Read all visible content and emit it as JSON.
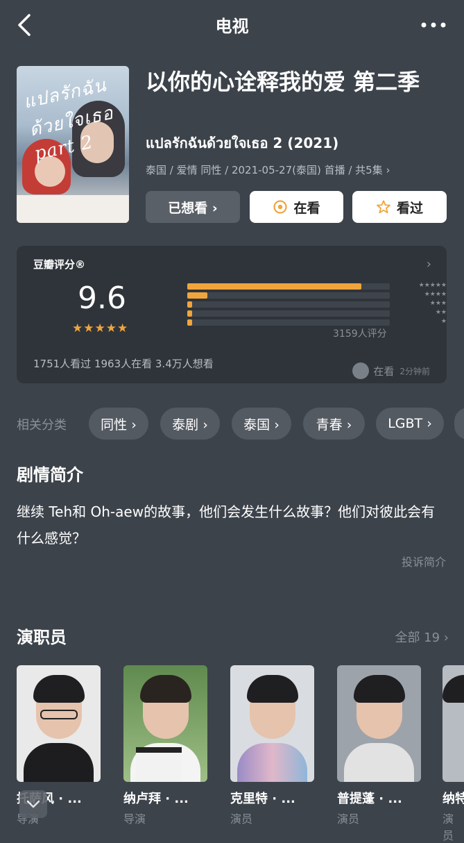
{
  "topbar": {
    "title": "电视"
  },
  "header": {
    "title_cn": "以你的心诠释我的爱 第二季",
    "title_orig": "แปลรักฉันด้วยใจเธอ 2 (2021)",
    "meta": "泰国 / 爱情 同性 / 2021-05-27(泰国) 首播 / 共5集 ›",
    "poster_script": "แปลรักฉัน ด้วยใจเธอ part 2",
    "buttons": {
      "wanted": "已想看 ›",
      "watching": "在看",
      "watched": "看过"
    }
  },
  "rating": {
    "title": "豆瓣评分®",
    "score": "9.6",
    "stars": "★★★★★",
    "distribution": [
      {
        "stars": "★★★★★",
        "fraction": 0.86
      },
      {
        "stars": "★★★★",
        "fraction": 0.1
      },
      {
        "stars": "★★★",
        "fraction": 0.02
      },
      {
        "stars": "★★",
        "fraction": 0.01
      },
      {
        "stars": "★",
        "fraction": 0.01
      }
    ],
    "votes": "3159人评分",
    "counts": "1751人看过   1963人在看   3.4万人想看",
    "activity_label": "在看",
    "activity_time": "2分钟前",
    "accent": "#f0a53c"
  },
  "related": {
    "label": "相关分类",
    "chips": [
      "同性 ›",
      "泰剧 ›",
      "泰国 ›",
      "青春 ›",
      "LGBT ›"
    ]
  },
  "synopsis": {
    "title": "剧情简介",
    "text": "继续 Teh和 Oh-aew的故事，他们会发生什么故事？他们对彼此会有什么感觉？",
    "report": "投诉简介"
  },
  "cast": {
    "title": "演职员",
    "all": "全部 19 ›",
    "members": [
      {
        "name": "托萨风 · ...",
        "role": "导演"
      },
      {
        "name": "纳卢拜 · ...",
        "role": "导演"
      },
      {
        "name": "克里特 · ...",
        "role": "演员"
      },
      {
        "name": "普提蓬 · ...",
        "role": "演员"
      },
      {
        "name": "纳特",
        "role": "演员"
      }
    ]
  }
}
